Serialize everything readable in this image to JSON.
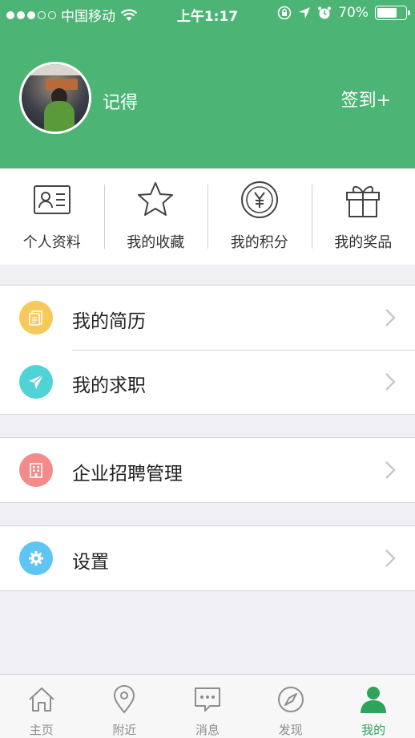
{
  "status_bar": {
    "carrier": "中国移动",
    "time": "上午1:17",
    "battery": "70%",
    "battery_level": 0.7,
    "signal_bars": 3,
    "signal_total": 5
  },
  "profile": {
    "username": "记得",
    "signin_label": "签到+"
  },
  "quick_actions": [
    {
      "label": "个人资料",
      "icon": "id-card-icon"
    },
    {
      "label": "我的收藏",
      "icon": "star-icon"
    },
    {
      "label": "我的积分",
      "icon": "yen-coin-icon"
    },
    {
      "label": "我的奖品",
      "icon": "gift-icon"
    }
  ],
  "menu": {
    "resume": {
      "label": "我的简历",
      "icon": "document-icon",
      "color": "#f7c95a"
    },
    "job_search": {
      "label": "我的求职",
      "icon": "paper-plane-icon",
      "color": "#4fd3d6"
    },
    "recruit": {
      "label": "企业招聘管理",
      "icon": "building-icon",
      "color": "#f58a8a"
    },
    "settings": {
      "label": "设置",
      "icon": "gear-icon",
      "color": "#5ec5f5"
    }
  },
  "tabs": [
    {
      "label": "主页",
      "icon": "home-icon",
      "active": false
    },
    {
      "label": "附近",
      "icon": "location-pin-icon",
      "active": false
    },
    {
      "label": "消息",
      "icon": "chat-bubble-icon",
      "active": false
    },
    {
      "label": "发现",
      "icon": "compass-icon",
      "active": false
    },
    {
      "label": "我的",
      "icon": "person-icon",
      "active": true
    }
  ],
  "colors": {
    "header_green": "#4cb575",
    "active_tab": "#2fa25b"
  }
}
